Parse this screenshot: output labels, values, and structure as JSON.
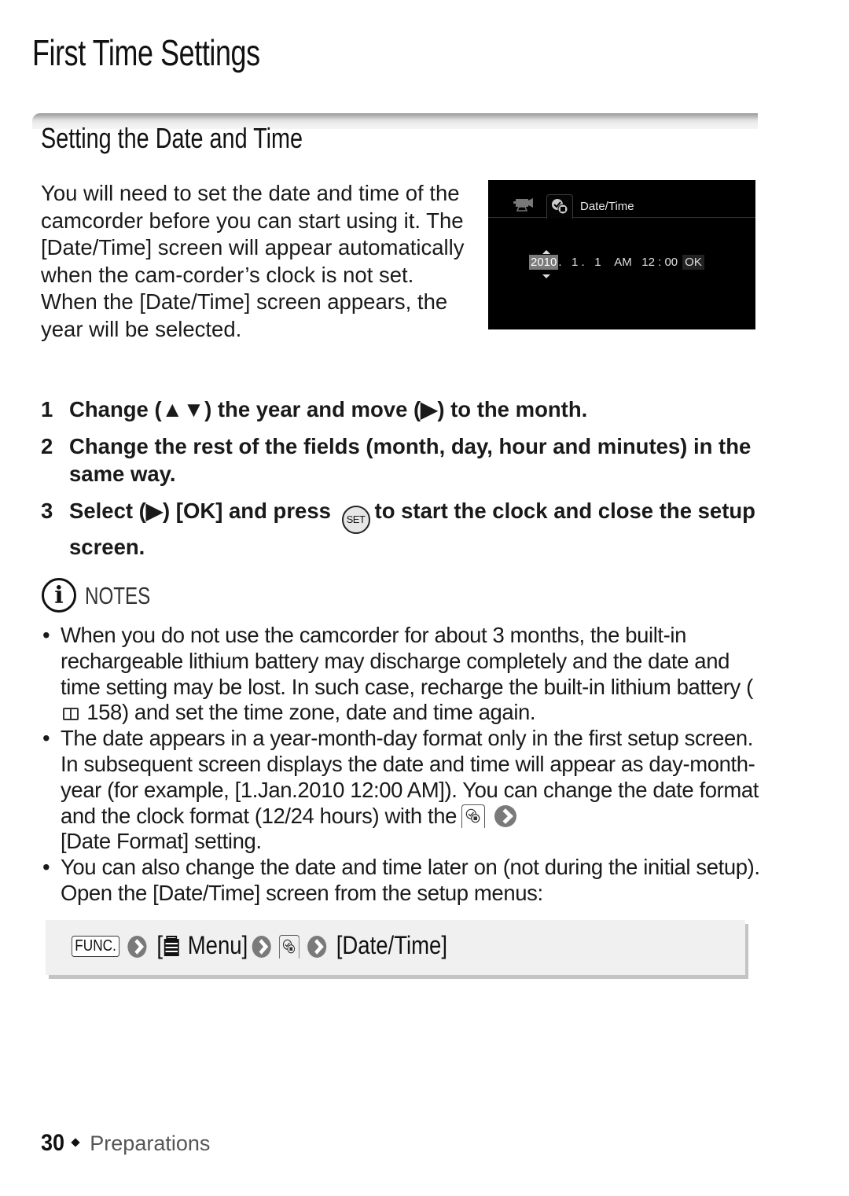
{
  "page": {
    "title": "First Time Settings",
    "section_title": "Setting the Date and Time"
  },
  "intro": {
    "paragraph1": "You will need to set the date and time of the camcorder before you can start using it. The [Date/Time] screen will appear automatically when the cam-corder’s clock is not set.",
    "paragraph2": "When the [Date/Time] screen appears, the year will be selected."
  },
  "lcd_screen": {
    "title": "Date/Time",
    "icons": [
      "camcorder-icon",
      "setup-tab-icon"
    ],
    "year": "2010",
    "month": "1",
    "day": "1",
    "ampm": "AM",
    "hour": "12",
    "minute": "00",
    "ok_label": "OK"
  },
  "steps": [
    {
      "number": "1",
      "parts": [
        "Change (",
        "▲▼",
        ") the year and move (",
        "▶",
        ") to the month."
      ]
    },
    {
      "number": "2",
      "text": "Change the rest of the fields (month, day, hour and minutes) in the same way."
    },
    {
      "number": "3",
      "parts": [
        "Select (",
        "▶",
        ") [OK] and press",
        "SET",
        "to start the clock and close the setup screen."
      ]
    }
  ],
  "notes": {
    "label": "NOTES",
    "items": [
      {
        "bullet": "•",
        "before_ref": "When you do not use the camcorder for about 3 months, the built-in rechargeable lithium battery may discharge completely and the date and time setting may be lost. In such case, recharge the built-in lithium battery (",
        "ref_page": "158",
        "after_ref": ") and set the time zone, date and time again."
      },
      {
        "bullet": "•",
        "before_icon": "The date appears in a year-month-day format only in the first setup screen. In subsequent screen displays the date and time will appear as day-month-year (for example, [1.Jan.2010 12:00 AM]). You can change the date format and the clock format (12/24 hours) with the",
        "after_icon": "[Date Format] setting."
      },
      {
        "bullet": "•",
        "text": "You can also change the date and time later on (not during the initial setup). Open the [Date/Time] screen from the setup menus:"
      }
    ]
  },
  "menu_path": {
    "func_label": "FUNC.",
    "menu_open": "[",
    "menu_label": "Menu]",
    "final_label": "[Date/Time]"
  },
  "footer": {
    "page_number": "30",
    "section": "Preparations"
  }
}
